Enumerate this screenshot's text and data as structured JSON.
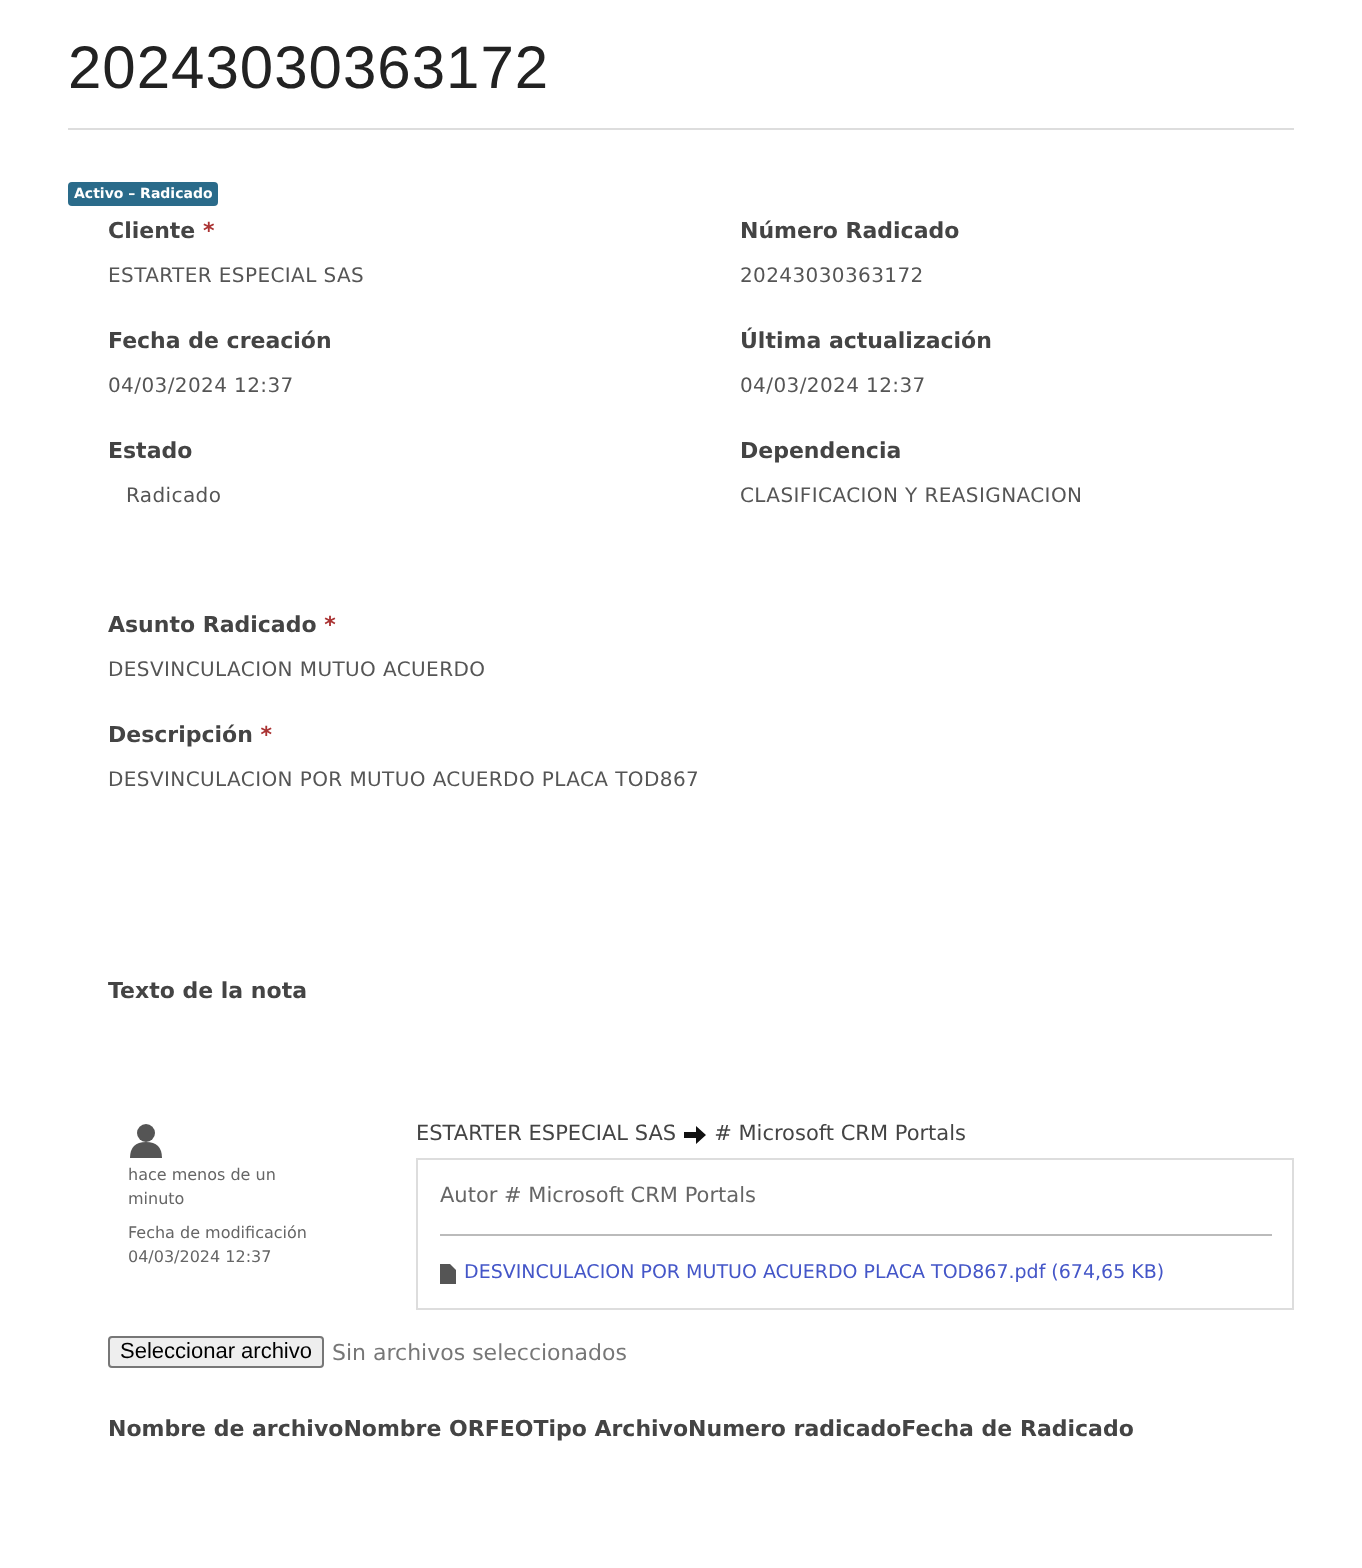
{
  "title": "20243030363172",
  "status_badge": "Activo – Radicado",
  "fields": [
    {
      "label": "Cliente",
      "required_mark": "*",
      "value": "ESTARTER ESPECIAL SAS"
    },
    {
      "label": "Número Radicado",
      "value": "20243030363172"
    },
    {
      "label": "Fecha de creación",
      "value": "04/03/2024 12:37"
    },
    {
      "label": "Última actualización",
      "value": "04/03/2024 12:37"
    },
    {
      "label": "Estado",
      "value": "Radicado",
      "indented": true
    },
    {
      "label": "Dependencia",
      "value": "CLASIFICACION Y REASIGNACION"
    }
  ],
  "subject": {
    "label": "Asunto Radicado",
    "required_mark": "*",
    "value": "DESVINCULACION MUTUO ACUERDO"
  },
  "description": {
    "label": "Descripción",
    "required_mark": "*",
    "value": "DESVINCULACION POR MUTUO ACUERDO PLACA TOD867"
  },
  "notes_label": "Texto de la nota",
  "note": {
    "time": "hace menos de un minuto",
    "modified_label": "Fecha de modificación",
    "modified": "04/03/2024 12:37",
    "from": "ESTARTER ESPECIAL SAS",
    "to": "# Microsoft CRM Portals",
    "author": "Autor # Microsoft CRM Portals",
    "attachment": "DESVINCULACION POR MUTUO ACUERDO PLACA TOD867.pdf (674,65 KB)"
  },
  "file_input": {
    "button": "Seleccionar archivo",
    "status": "Sin archivos seleccionados"
  },
  "table": {
    "columns": [
      "Nombre de archivo",
      "Nombre ORFEO",
      "Tipo Archivo",
      "Numero radicado",
      "Fecha de Radicado"
    ]
  }
}
